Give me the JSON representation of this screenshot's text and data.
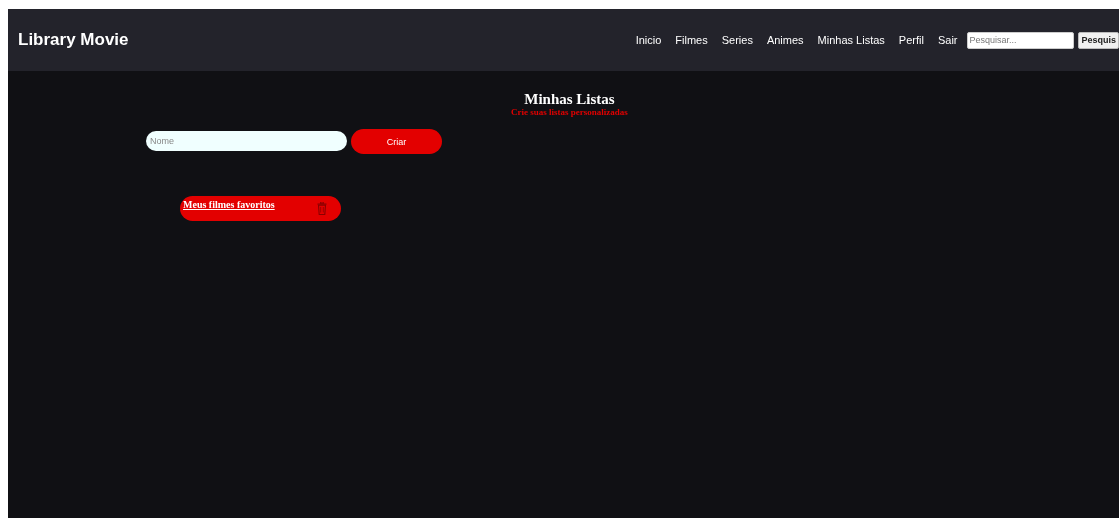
{
  "header": {
    "logo": "Library Movie",
    "nav": [
      "Inicio",
      "Filmes",
      "Series",
      "Animes",
      "Minhas Listas",
      "Perfil",
      "Sair"
    ],
    "search": {
      "placeholder": "Pesquisar...",
      "button": "Pesquis"
    }
  },
  "page": {
    "title": "Minhas Listas",
    "subtitle": "Crie suas listas personalizadas"
  },
  "form": {
    "placeholder": "Nome",
    "button": "Criar"
  },
  "lists": [
    {
      "name": "Meus filmes favoritos"
    }
  ]
}
